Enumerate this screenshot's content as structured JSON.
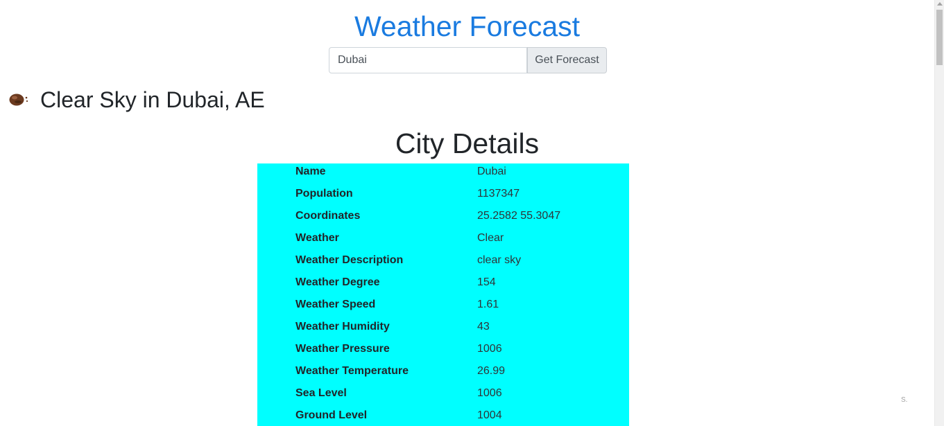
{
  "app": {
    "title": "Weather Forecast"
  },
  "search": {
    "value": "Dubai",
    "button_label": "Get Forecast"
  },
  "summary": {
    "icon": "clear-sky-weather-icon",
    "text": "Clear Sky in Dubai, AE"
  },
  "details": {
    "title": "City Details",
    "background_color": "#00ffff",
    "rows": [
      {
        "label": "Name",
        "value": "Dubai"
      },
      {
        "label": "Population",
        "value": "1137347"
      },
      {
        "label": "Coordinates",
        "value": "25.2582 55.3047"
      },
      {
        "label": "Weather",
        "value": "Clear"
      },
      {
        "label": "Weather Description",
        "value": "clear sky"
      },
      {
        "label": "Weather Degree",
        "value": "154"
      },
      {
        "label": "Weather Speed",
        "value": "1.61"
      },
      {
        "label": "Weather Humidity",
        "value": "43"
      },
      {
        "label": "Weather Pressure",
        "value": "1006"
      },
      {
        "label": "Weather Temperature",
        "value": "26.99"
      },
      {
        "label": "Sea Level",
        "value": "1006"
      },
      {
        "label": "Ground Level",
        "value": "1004"
      }
    ]
  },
  "footer": {
    "corner_mark": "S."
  },
  "colors": {
    "title_blue": "#1a7be0",
    "table_bg": "#00ffff"
  }
}
